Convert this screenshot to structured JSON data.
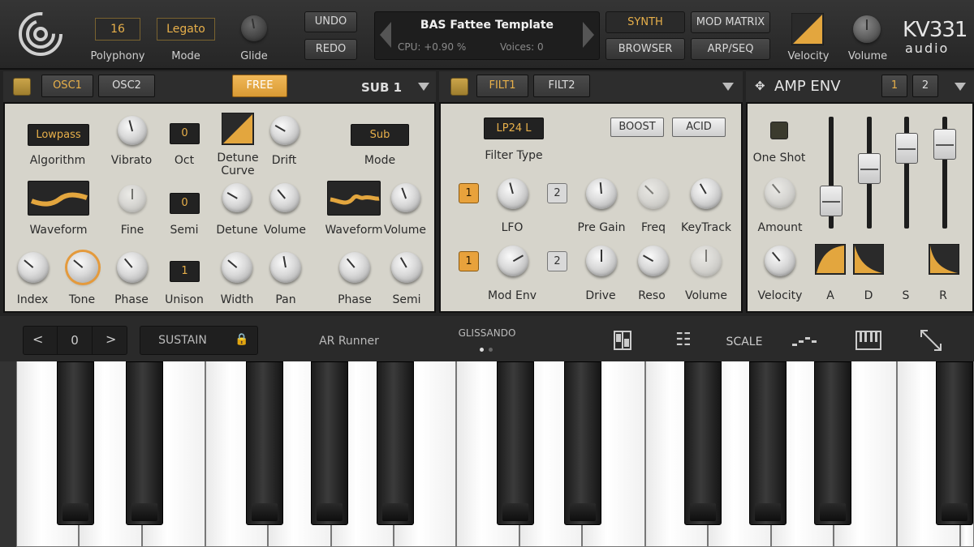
{
  "topbar": {
    "polyphony_value": "16",
    "polyphony_label": "Polyphony",
    "mode_value": "Legato",
    "mode_label": "Mode",
    "glide_label": "Glide",
    "undo": "UNDO",
    "redo": "REDO",
    "preset_name": "BAS Fattee Template",
    "cpu": "CPU: +0.90 %",
    "voices": "Voices: 0",
    "synth": "SYNTH",
    "mod_matrix": "MOD MATRIX",
    "browser": "BROWSER",
    "arp_seq": "ARP/SEQ",
    "velocity_label": "Velocity",
    "volume_label": "Volume",
    "brand_line1": "KV331",
    "brand_line2": "audio"
  },
  "osc": {
    "tab1": "OSC1",
    "tab2": "OSC2",
    "free": "FREE",
    "sub_title": "SUB 1",
    "algorithm_value": "Lowpass",
    "algorithm_label": "Algorithm",
    "vibrato_label": "Vibrato",
    "oct_value": "0",
    "oct_label": "Oct",
    "detune_curve_label1": "Detune",
    "detune_curve_label2": "Curve",
    "drift_label": "Drift",
    "sub_mode_value": "Sub",
    "sub_mode_label": "Mode",
    "waveform_label": "Waveform",
    "fine_label": "Fine",
    "semi_value": "0",
    "semi_label": "Semi",
    "detune_label": "Detune",
    "volume_label": "Volume",
    "sub_waveform_label": "Waveform",
    "sub_volume_label": "Volume",
    "index_label": "Index",
    "tone_label": "Tone",
    "phase_label": "Phase",
    "unison_value": "1",
    "unison_label": "Unison",
    "width_label": "Width",
    "pan_label": "Pan",
    "sub_phase_label": "Phase",
    "sub_semi_label": "Semi"
  },
  "filter": {
    "tab1": "FILT1",
    "tab2": "FILT2",
    "type_value": "LP24 L",
    "type_label": "Filter Type",
    "boost": "BOOST",
    "acid": "ACID",
    "lfo_btn1": "1",
    "lfo_btn2": "2",
    "lfo_label": "LFO",
    "pre_gain_label": "Pre Gain",
    "freq_label": "Freq",
    "keytrack_label": "KeyTrack",
    "env_btn1": "1",
    "env_btn2": "2",
    "mod_env_label": "Mod Env",
    "drive_label": "Drive",
    "reso_label": "Reso",
    "volume_label": "Volume"
  },
  "amp": {
    "title": "AMP ENV",
    "tab1": "1",
    "tab2": "2",
    "one_shot_label": "One Shot",
    "amount_label": "Amount",
    "velocity_label": "Velocity",
    "a_label": "A",
    "d_label": "D",
    "s_label": "S",
    "r_label": "R",
    "slider_levels": {
      "A": 0.15,
      "D": 0.55,
      "S": 0.8,
      "R": 0.85
    }
  },
  "keyboard_bar": {
    "octave_value": "0",
    "sustain": "SUSTAIN",
    "preset_label": "AR Runner",
    "glissando": "GLISSANDO",
    "scale": "SCALE"
  },
  "colors": {
    "accent": "#e8b04a",
    "panel": "#d6d4cb",
    "orange": "#e8a23c"
  }
}
